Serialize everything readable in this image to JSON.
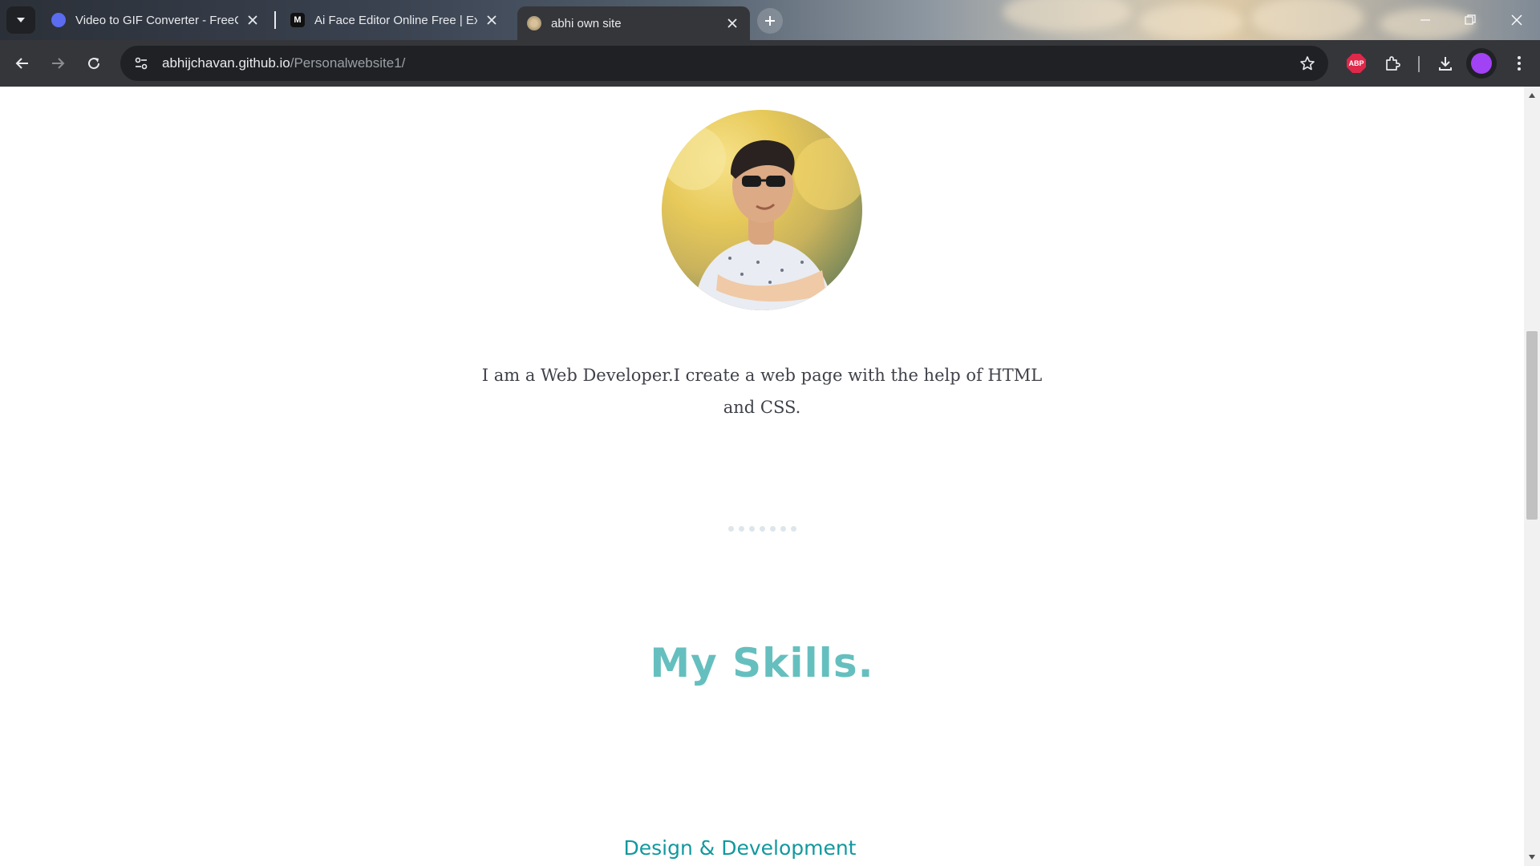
{
  "browser": {
    "tabs": [
      {
        "title": "Video to GIF Converter - FreeConvert",
        "favicon_color": "#5b6cf0",
        "active": false
      },
      {
        "title": "Ai Face Editor Online Free | Expression Editor",
        "favicon_color": "#111111",
        "active": false
      },
      {
        "title": "abhi own site",
        "favicon_color": "#c9b07a",
        "active": true
      }
    ],
    "url_host": "abhijchavan.github.io",
    "url_path": "/Personalwebsite1/",
    "extension_abp_label": "ABP",
    "icons": {
      "tab_search": "chevron-down-icon",
      "new_tab": "plus-icon",
      "back": "arrow-left-icon",
      "forward": "arrow-right-icon",
      "reload": "reload-icon",
      "site_info": "tune-icon",
      "bookmark": "star-icon",
      "extensions": "puzzle-icon",
      "downloads": "download-icon",
      "menu": "kebab-menu-icon"
    },
    "profile_color": "#a142f4"
  },
  "page": {
    "bio": "I am a Web Developer.I create a web page with the help of HTML and CSS.",
    "section_title": "My Skills.",
    "skill_heading": "Design & Development",
    "colors": {
      "title": "#66bfbf",
      "skill_heading": "#11999e",
      "bio_text": "#40424a"
    }
  }
}
